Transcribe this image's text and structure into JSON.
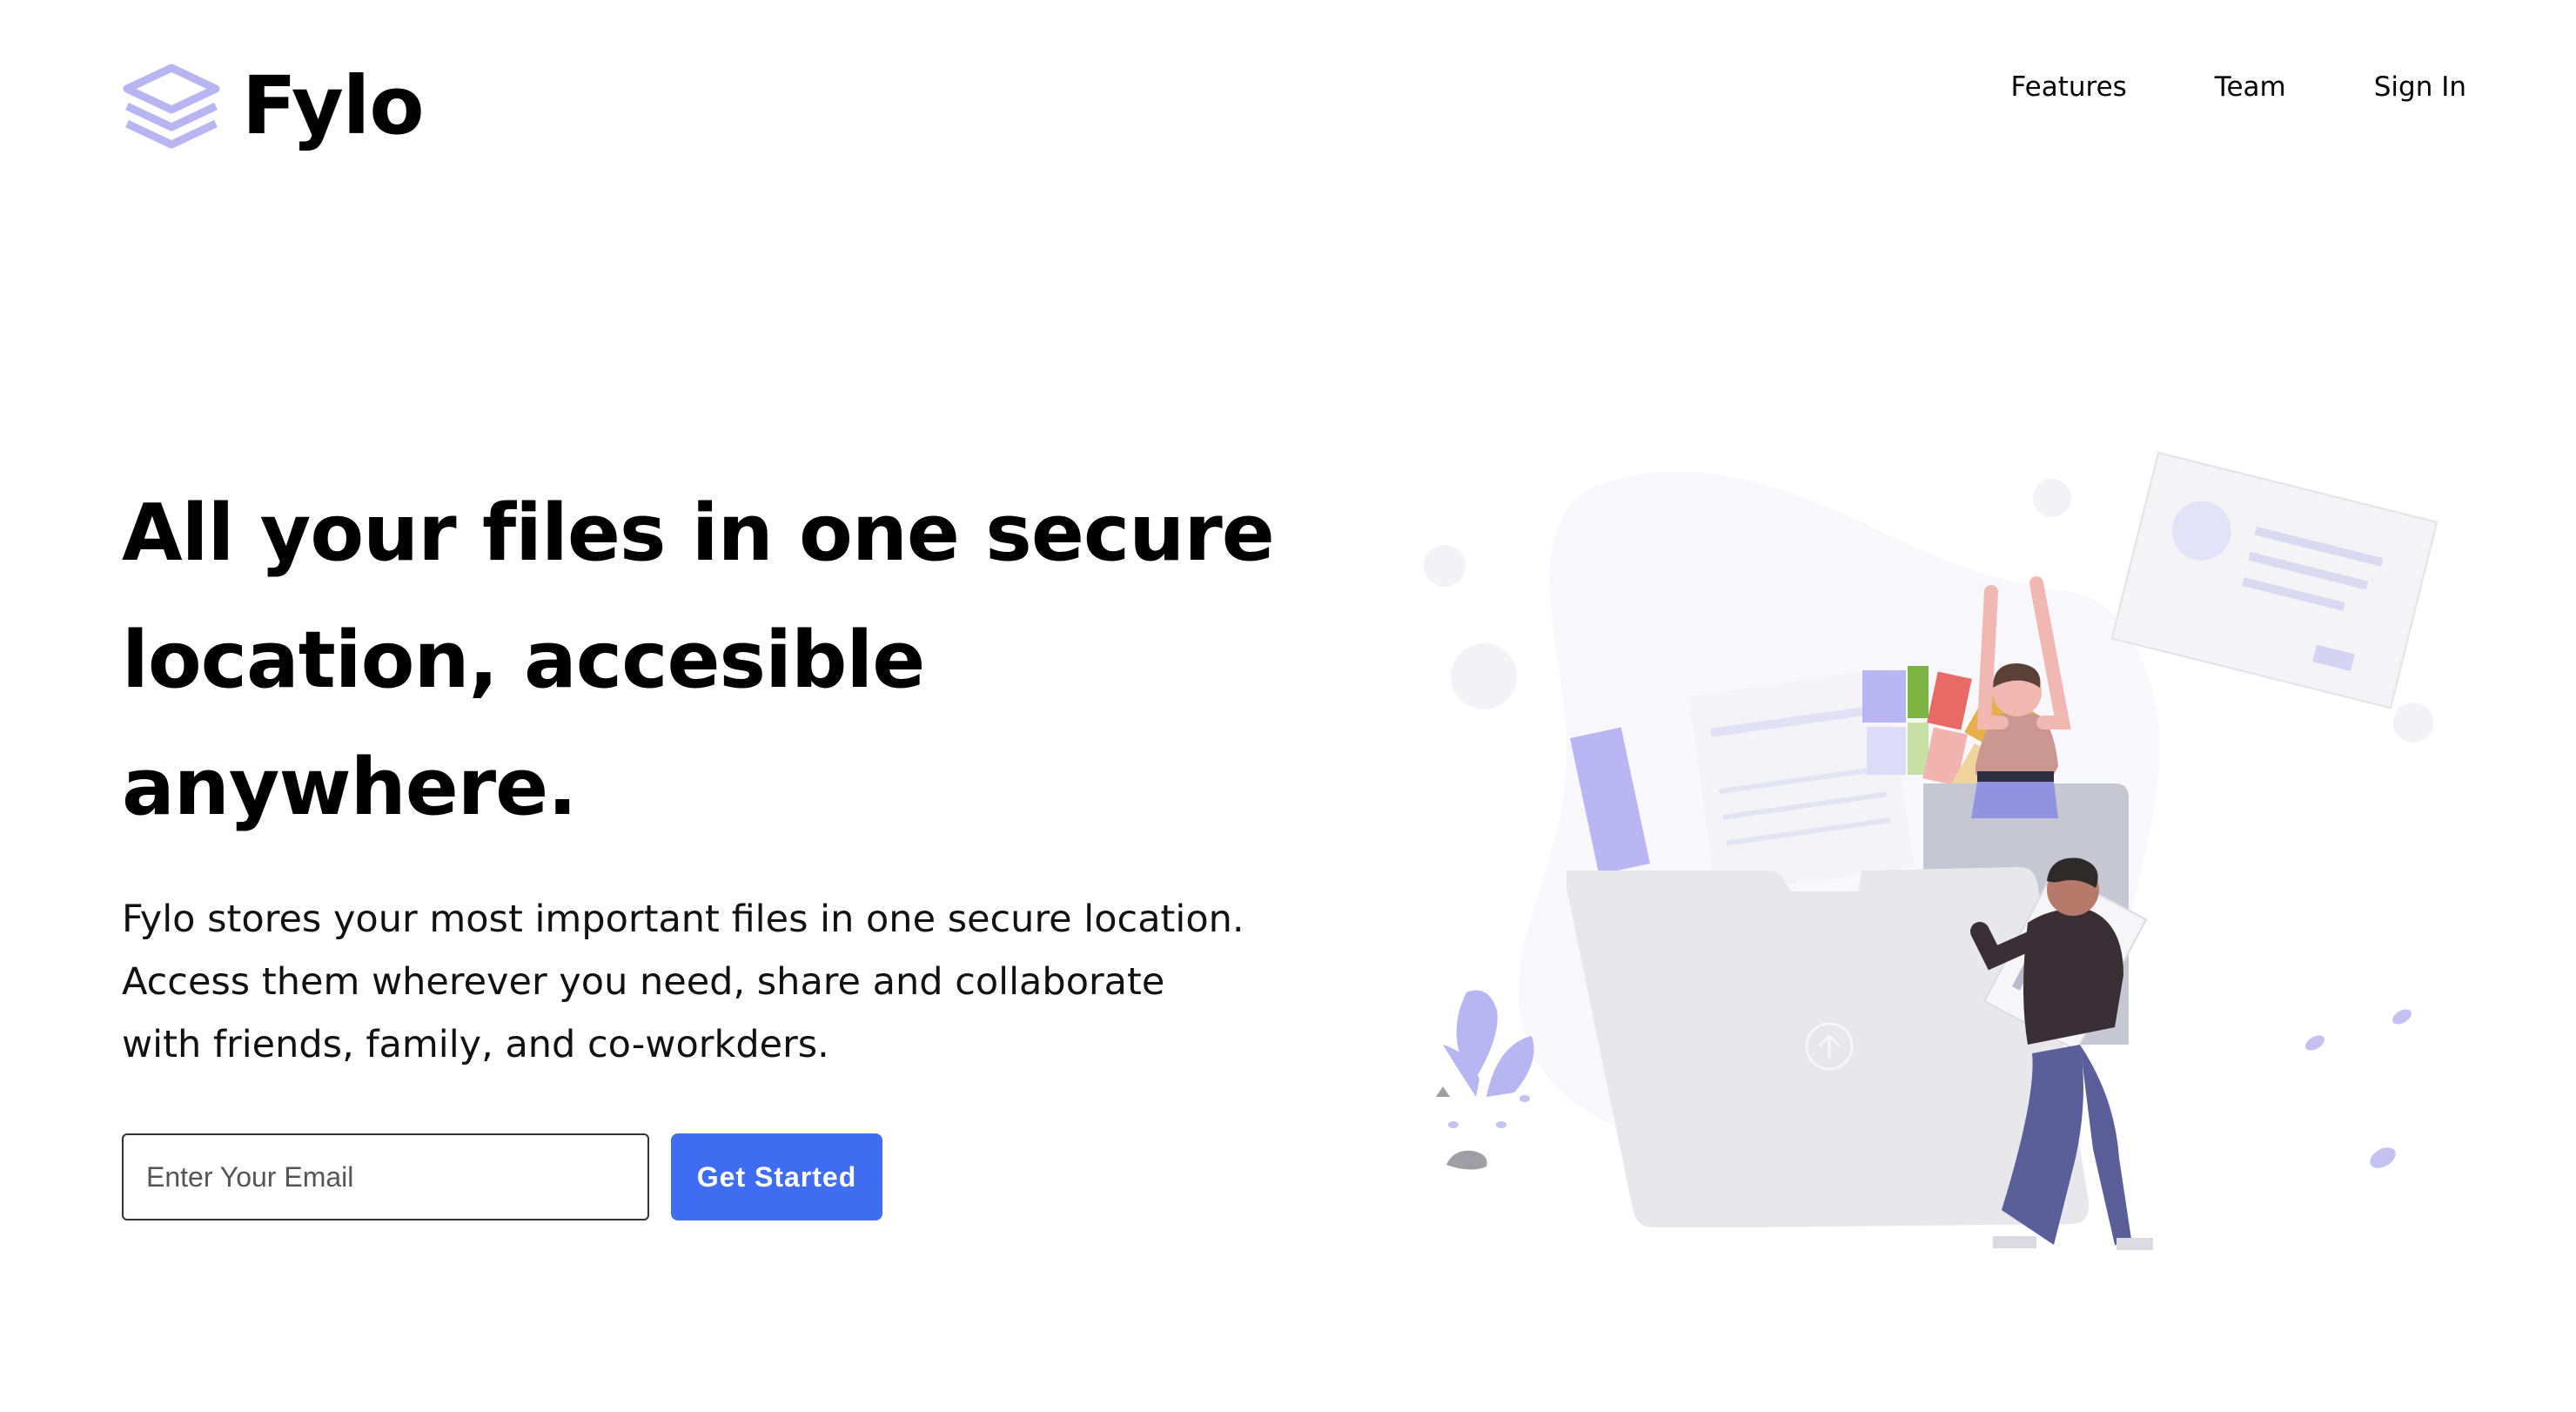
{
  "brand": {
    "name": "Fylo",
    "logo_icon": "stacked-layers-icon",
    "logo_color": "#b8b6f2"
  },
  "nav": {
    "items": [
      {
        "label": "Features"
      },
      {
        "label": "Team"
      },
      {
        "label": "Sign In"
      }
    ]
  },
  "hero": {
    "title": "All your files in one secure location, accesible anywhere.",
    "description": "Fylo stores your most important files in one secure location. Access them wherever you need, share and collaborate with friends, family, and co-workders.",
    "email_placeholder": "Enter Your Email",
    "email_value": "",
    "cta_label": "Get Started",
    "illustration": "files-folder-people-illustration"
  },
  "colors": {
    "accent": "#3f6cf0",
    "text": "#000000",
    "background": "#ffffff",
    "illustration_purple": "#b8b6f2"
  }
}
